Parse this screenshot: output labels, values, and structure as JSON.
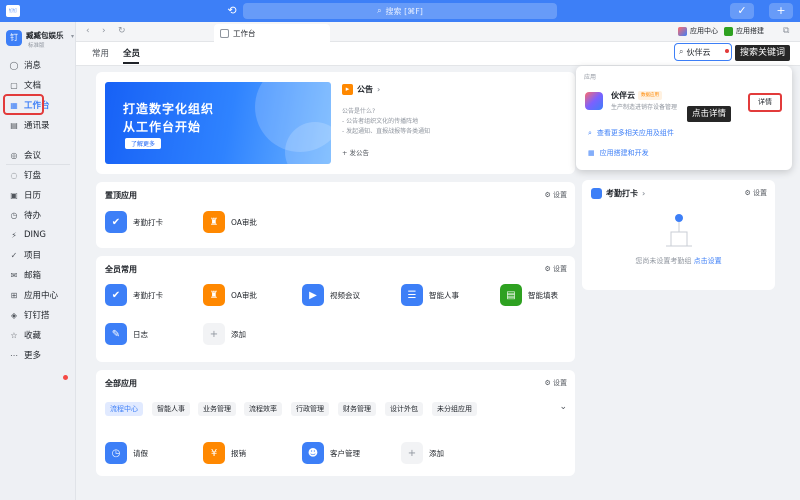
{
  "topbar": {
    "logo_text": "钉钉",
    "search_placeholder": "搜索 [⌘F]",
    "edit_icon": "✓",
    "add_icon": "+"
  },
  "org": {
    "avatar": "钉",
    "name": "臧臧包娱乐",
    "sub": "标准版"
  },
  "sidebar": {
    "items": [
      {
        "label": "消息",
        "icon": "chat-icon"
      },
      {
        "label": "文档",
        "icon": "doc-icon"
      },
      {
        "label": "工作台",
        "icon": "grid-icon"
      },
      {
        "label": "通讯录",
        "icon": "contacts-icon"
      },
      {
        "label": "会议",
        "icon": "meeting-icon"
      },
      {
        "label": "钉盘",
        "icon": "cloud-icon"
      },
      {
        "label": "日历",
        "icon": "calendar-icon"
      },
      {
        "label": "待办",
        "icon": "todo-icon"
      },
      {
        "label": "DING",
        "icon": "ding-icon"
      },
      {
        "label": "项目",
        "icon": "project-icon"
      },
      {
        "label": "邮箱",
        "icon": "mail-icon"
      },
      {
        "label": "应用中心",
        "icon": "apps-icon"
      },
      {
        "label": "钉钉搭",
        "icon": "build-icon"
      },
      {
        "label": "收藏",
        "icon": "star-icon"
      },
      {
        "label": "更多",
        "icon": "more-icon"
      }
    ]
  },
  "tabbar": {
    "tab_label": "工作台",
    "app_center": "应用中心",
    "app_build": "应用搭建"
  },
  "subtabs": {
    "common": "常用",
    "all": "全员"
  },
  "search": {
    "value": "伙伴云",
    "callout": "搜索关键词"
  },
  "banner": {
    "line1": "打造数字化组织",
    "line2": "从工作台开始",
    "button": "了解更多"
  },
  "announcement": {
    "title": "公告",
    "lines": [
      "公告是什么?",
      "- 公告者组织文化的传播阵地",
      "- 发起通知、直报战报等各类通知"
    ],
    "add": "+ 发公告"
  },
  "pinned": {
    "title": "置顶应用",
    "settings": "设置",
    "apps": [
      {
        "label": "考勤打卡",
        "icon": "check-in-icon",
        "color": "#3d7ff7"
      },
      {
        "label": "OA审批",
        "icon": "stamp-icon",
        "color": "#ff8800"
      }
    ]
  },
  "common_apps": {
    "title": "全员常用",
    "settings": "设置",
    "apps": [
      {
        "label": "考勤打卡",
        "icon": "check-in-icon",
        "color": "#3d7ff7"
      },
      {
        "label": "OA审批",
        "icon": "stamp-icon",
        "color": "#ff8800"
      },
      {
        "label": "视频会议",
        "icon": "video-icon",
        "color": "#3d7ff7"
      },
      {
        "label": "智能人事",
        "icon": "people-icon",
        "color": "#3d7ff7"
      },
      {
        "label": "智能填表",
        "icon": "form-icon",
        "color": "#2ea121"
      },
      {
        "label": "日志",
        "icon": "log-icon",
        "color": "#3d7ff7"
      },
      {
        "label": "添加",
        "icon": "plus-icon",
        "color": "#8f959e"
      }
    ]
  },
  "all_apps": {
    "title": "全部应用",
    "settings": "设置",
    "chips": [
      "流程中心",
      "智能人事",
      "业务管理",
      "流程效率",
      "行政管理",
      "财务管理",
      "设计外包",
      "未分组应用"
    ],
    "apps": [
      {
        "label": "请假",
        "icon": "clock-icon",
        "color": "#3d7ff7"
      },
      {
        "label": "报销",
        "icon": "money-bag-icon",
        "color": "#ff8800"
      },
      {
        "label": "客户管理",
        "icon": "customer-icon",
        "color": "#3d7ff7"
      },
      {
        "label": "添加",
        "icon": "plus-icon",
        "color": "#8f959e"
      }
    ]
  },
  "attendance_card": {
    "title": "考勤打卡",
    "settings": "设置",
    "empty_text": "您尚未设置考勤组",
    "link": "点击设置"
  },
  "dropdown": {
    "label": "应用",
    "app_name": "伙伴云",
    "badge": "数据应用",
    "desc": "生产制造进销存设备管理",
    "detail_button": "详情",
    "detail_callout": "点击详情",
    "more_link": "查看更多相关应用及组件",
    "build_link": "应用搭建和开发"
  },
  "colors": {
    "accent": "#3d7ff7",
    "highlight": "#e23b3b",
    "callout_bg": "#262626"
  }
}
